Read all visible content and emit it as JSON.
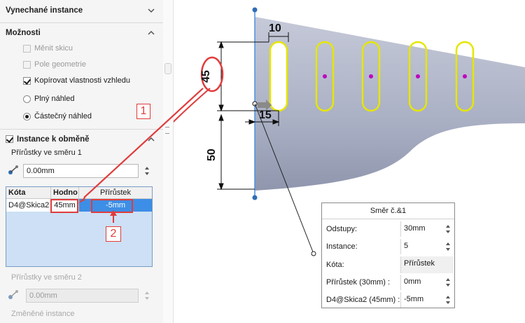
{
  "panel": {
    "skipped_title": "Vynechané instance",
    "options_title": "Možnosti",
    "options": [
      {
        "label": "Měnit skicu",
        "checked": false,
        "enabled": false
      },
      {
        "label": "Pole geometrie",
        "checked": false,
        "enabled": false
      },
      {
        "label": "Kopírovat vlastnosti vzhledu",
        "checked": true,
        "enabled": true
      }
    ],
    "preview": [
      {
        "label": "Plný náhled",
        "selected": false
      },
      {
        "label": "Částečný náhled",
        "selected": true
      }
    ],
    "vary_title": "Instance k obměně",
    "dir1_label": "Přírůstky ve směru 1",
    "dir1_value": "0.00mm",
    "table": {
      "headers": [
        "Kóta",
        "Hodno",
        "Přírůstek"
      ],
      "row": [
        "D4@Skica2",
        "45mm",
        "-5mm"
      ]
    },
    "dir2_label": "Přírůstky ve směru 2",
    "dir2_value": "0.00mm",
    "changed_label": "Změněné instance"
  },
  "callouts": [
    "1",
    "2"
  ],
  "drawing": {
    "dims": [
      "10",
      "45",
      "15",
      "50"
    ],
    "colors": {
      "slot": "#e6e600",
      "highlight": "#e03c3c",
      "body": "#aeb3c6",
      "axis": "#4a90e2"
    }
  },
  "dialog": {
    "title": "Směr č.&1",
    "rows": [
      {
        "label": "Odstupy:",
        "value": "30mm",
        "spinner": true
      },
      {
        "label": "Instance:",
        "value": "5",
        "spinner": true
      },
      {
        "label": "Kóta:",
        "value": "Přírůstek",
        "spinner": false
      },
      {
        "label": "Přírůstek (30mm) :",
        "value": "0mm",
        "spinner": true
      },
      {
        "label": "D4@Skica2 (45mm) :",
        "value": "-5mm",
        "spinner": true
      }
    ]
  }
}
